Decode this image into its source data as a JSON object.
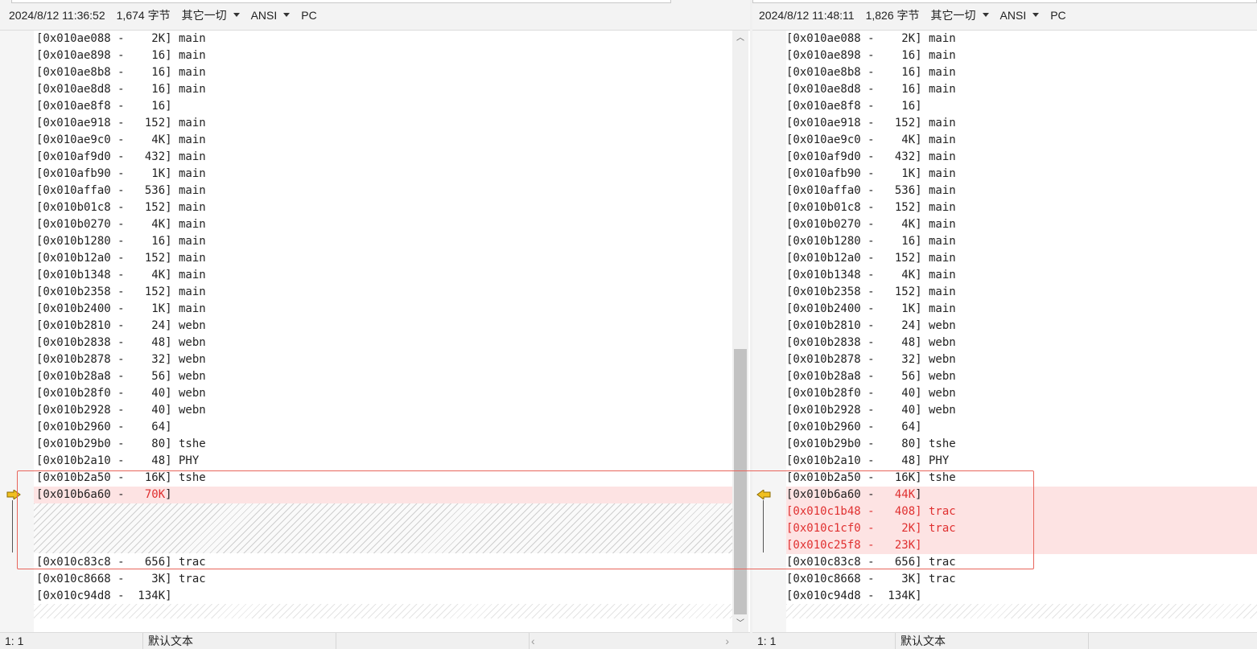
{
  "left": {
    "timestamp": "2024/8/12 11:36:52",
    "size": "1,674 字节",
    "filter": "其它一切",
    "encoding": "ANSI",
    "line_ending": "PC",
    "lines": [
      "[0x010ae088 -    2K] main",
      "[0x010ae898 -    16] main",
      "[0x010ae8b8 -    16] main",
      "[0x010ae8d8 -    16] main",
      "[0x010ae8f8 -    16]",
      "[0x010ae918 -   152] main",
      "[0x010ae9c0 -    4K] main",
      "[0x010af9d0 -   432] main",
      "[0x010afb90 -    1K] main",
      "[0x010affa0 -   536] main",
      "[0x010b01c8 -   152] main",
      "[0x010b0270 -    4K] main",
      "[0x010b1280 -    16] main",
      "[0x010b12a0 -   152] main",
      "[0x010b1348 -    4K] main",
      "[0x010b2358 -   152] main",
      "[0x010b2400 -    1K] main",
      "[0x010b2810 -    24] webn",
      "[0x010b2838 -    48] webn",
      "[0x010b2878 -    32] webn",
      "[0x010b28a8 -    56] webn",
      "[0x010b28f0 -    40] webn",
      "[0x010b2928 -    40] webn",
      "[0x010b2960 -    64]",
      "[0x010b29b0 -    80] tshe",
      "[0x010b2a10 -    48] PHY",
      "[0x010b2a50 -   16K] tshe"
    ],
    "changed_line": {
      "prefix": "[0x010b6a60 -   ",
      "value": "70K",
      "suffix": "]"
    },
    "after_lines": [
      "[0x010c83c8 -   656] trac",
      "[0x010c8668 -    3K] trac",
      "[0x010c94d8 -  134K]"
    ],
    "status": {
      "position": "1: 1",
      "syntax": "默认文本"
    }
  },
  "right": {
    "timestamp": "2024/8/12 11:48:11",
    "size": "1,826 字节",
    "filter": "其它一切",
    "encoding": "ANSI",
    "line_ending": "PC",
    "lines": [
      "[0x010ae088 -    2K] main",
      "[0x010ae898 -    16] main",
      "[0x010ae8b8 -    16] main",
      "[0x010ae8d8 -    16] main",
      "[0x010ae8f8 -    16]",
      "[0x010ae918 -   152] main",
      "[0x010ae9c0 -    4K] main",
      "[0x010af9d0 -   432] main",
      "[0x010afb90 -    1K] main",
      "[0x010affa0 -   536] main",
      "[0x010b01c8 -   152] main",
      "[0x010b0270 -    4K] main",
      "[0x010b1280 -    16] main",
      "[0x010b12a0 -   152] main",
      "[0x010b1348 -    4K] main",
      "[0x010b2358 -   152] main",
      "[0x010b2400 -    1K] main",
      "[0x010b2810 -    24] webn",
      "[0x010b2838 -    48] webn",
      "[0x010b2878 -    32] webn",
      "[0x010b28a8 -    56] webn",
      "[0x010b28f0 -    40] webn",
      "[0x010b2928 -    40] webn",
      "[0x010b2960 -    64]",
      "[0x010b29b0 -    80] tshe",
      "[0x010b2a10 -    48] PHY",
      "[0x010b2a50 -   16K] tshe"
    ],
    "changed_line": {
      "prefix": "[0x010b6a60 -   ",
      "value": "44K",
      "suffix": "]"
    },
    "inserted_lines": [
      "[0x010c1b48 -   408] trac",
      "[0x010c1cf0 -    2K] trac",
      "[0x010c25f8 -   23K]"
    ],
    "after_lines": [
      "[0x010c83c8 -   656] trac",
      "[0x010c8668 -    3K] trac",
      "[0x010c94d8 -  134K]"
    ],
    "status": {
      "position": "1: 1",
      "syntax": "默认文本"
    }
  },
  "colors": {
    "changed_text": "#e03030",
    "changed_bg": "#fde3e3",
    "highlight_box": "#e8655c",
    "marker": "#f0c020"
  },
  "icons": {
    "left_marker": "arrow-right-icon",
    "right_marker": "arrow-left-icon"
  }
}
